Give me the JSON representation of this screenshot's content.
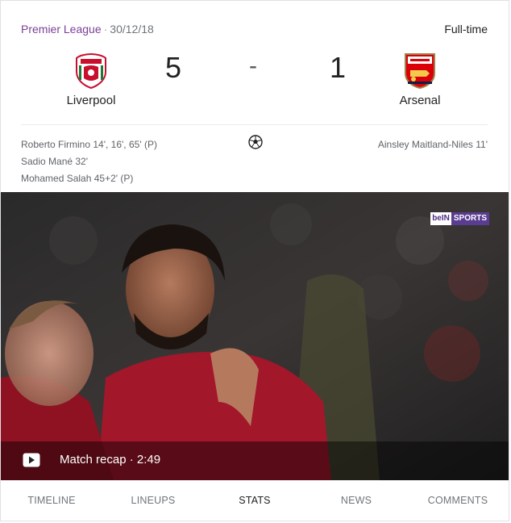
{
  "match": {
    "league": "Premier League",
    "separator": "·",
    "date": "30/12/18",
    "status": "Full-time"
  },
  "home": {
    "name": "Liverpool",
    "score": "5",
    "crest_icon": "liverpool-crest-icon",
    "crest_color": "#c8102e",
    "scorers": [
      "Roberto Firmino 14', 16', 65' (P)",
      "Sadio Mané 32'",
      "Mohamed Salah 45+2' (P)"
    ]
  },
  "away": {
    "name": "Arsenal",
    "score": "1",
    "crest_icon": "arsenal-crest-icon",
    "crest_color": "#db0007",
    "scorers": [
      "Ainsley Maitland-Niles 11'"
    ]
  },
  "score_separator": "-",
  "goal_icon": "soccer-ball-icon",
  "video": {
    "broadcaster_part1": "beIN",
    "broadcaster_part2": "SPORTS",
    "play_icon": "play-icon",
    "recap_label": "Match recap · 2:49"
  },
  "tabs": [
    {
      "label": "TIMELINE",
      "active": false
    },
    {
      "label": "LINEUPS",
      "active": false
    },
    {
      "label": "STATS",
      "active": true
    },
    {
      "label": "NEWS",
      "active": false
    },
    {
      "label": "COMMENTS",
      "active": false
    }
  ]
}
